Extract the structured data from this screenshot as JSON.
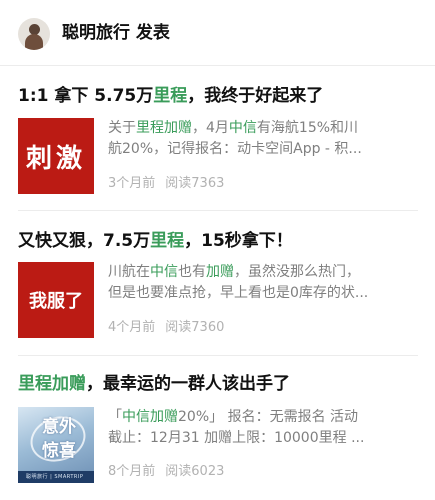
{
  "header": {
    "account_name": "聪明旅行",
    "action": "发表"
  },
  "articles": [
    {
      "title_parts": [
        {
          "text": "1:1 拿下 5.75万",
          "hl": false
        },
        {
          "text": "里程",
          "hl": true
        },
        {
          "text": "，我终于好起来了",
          "hl": false
        }
      ],
      "thumb_text": "刺激",
      "summary_line1": [
        {
          "text": "关于",
          "hl": false
        },
        {
          "text": "里程加赠",
          "hl": true
        },
        {
          "text": "，4月",
          "hl": false
        },
        {
          "text": "中信",
          "hl": true
        },
        {
          "text": "有海航15%和川",
          "hl": false
        }
      ],
      "summary_line2": [
        {
          "text": "航20%，记得报名：动卡空间App - 积...",
          "hl": false
        }
      ],
      "time": "3个月前",
      "reads": "阅读7363"
    },
    {
      "title_parts": [
        {
          "text": "又快又狠，7.5万",
          "hl": false
        },
        {
          "text": "里程",
          "hl": true
        },
        {
          "text": "，15秒拿下！",
          "hl": false
        }
      ],
      "thumb_text": "我服了",
      "summary_line1": [
        {
          "text": "川航在",
          "hl": false
        },
        {
          "text": "中信",
          "hl": true
        },
        {
          "text": "也有",
          "hl": false
        },
        {
          "text": "加赠",
          "hl": true
        },
        {
          "text": "，虽然没那么热门，",
          "hl": false
        }
      ],
      "summary_line2": [
        {
          "text": "但是也要准点抢，早上看也是0库存的状...",
          "hl": false
        }
      ],
      "time": "4个月前",
      "reads": "阅读7360"
    },
    {
      "title_parts": [
        {
          "text": "里程加赠",
          "hl": true
        },
        {
          "text": "，最幸运的一群人该出手了",
          "hl": false
        }
      ],
      "thumb_text": "意外惊喜",
      "thumb_footer": "聪明旅行 | SMARTRIP",
      "summary_line1": [
        {
          "text": "「",
          "hl": false
        },
        {
          "text": "中信加赠",
          "hl": true
        },
        {
          "text": "20%」 报名：无需报名 活动",
          "hl": false
        }
      ],
      "summary_line2": [
        {
          "text": "截止：12月31 加赠上限：10000里程 ...",
          "hl": false
        }
      ],
      "time": "8个月前",
      "reads": "阅读6023"
    }
  ]
}
